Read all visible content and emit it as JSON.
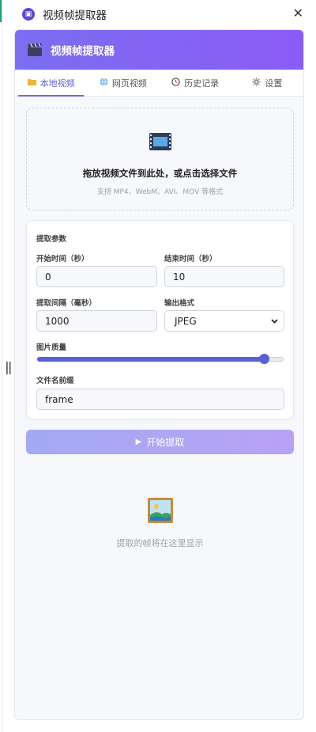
{
  "window": {
    "title": "视频帧提取器",
    "app_icon": "film-icon",
    "close": "✕"
  },
  "header": {
    "title": "视频帧提取器"
  },
  "tabs": [
    {
      "label": "本地视频",
      "icon": "folder-icon",
      "active": true
    },
    {
      "label": "网页视频",
      "icon": "globe-icon",
      "active": false
    },
    {
      "label": "历史记录",
      "icon": "clock-icon",
      "active": false
    },
    {
      "label": "设置",
      "icon": "gear-icon",
      "active": false
    }
  ],
  "dropzone": {
    "title": "拖放视频文件到此处，或点击选择文件",
    "hint": "支持 MP4、WebM、AVI、MOV 等格式"
  },
  "params": {
    "section_title": "提取参数",
    "start_time": {
      "label": "开始时间（秒）",
      "value": "0"
    },
    "end_time": {
      "label": "结束时间（秒）",
      "value": "10"
    },
    "interval": {
      "label": "提取间隔（毫秒）",
      "value": "1000"
    },
    "format": {
      "label": "输出格式",
      "value": "JPEG"
    },
    "quality": {
      "label": "图片质量",
      "value": 0.92
    },
    "prefix": {
      "label": "文件名前缀",
      "value": "frame"
    }
  },
  "start_button": {
    "label": "开始提取"
  },
  "empty_state": {
    "text": "提取的帧将在这里显示",
    "icon": "picture-icon"
  },
  "colors": {
    "accent": "#5b5fd6",
    "header_gradient_start": "#7b6ef0",
    "header_gradient_end": "#8b5cf6"
  }
}
